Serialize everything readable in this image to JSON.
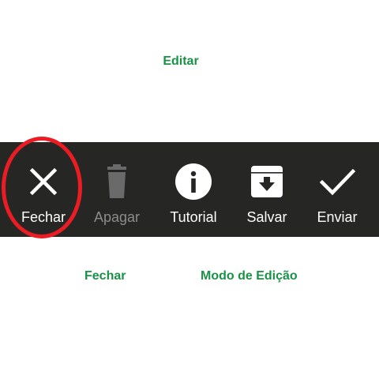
{
  "captions": {
    "top": "Editar",
    "bottom_left": "Fechar",
    "bottom_right": "Modo de Edição"
  },
  "toolbar": {
    "items": [
      {
        "label": "Fechar",
        "icon": "close-icon",
        "enabled": true
      },
      {
        "label": "Apagar",
        "icon": "trash-icon",
        "enabled": false
      },
      {
        "label": "Tutorial",
        "icon": "info-icon",
        "enabled": true
      },
      {
        "label": "Salvar",
        "icon": "archive-download-icon",
        "enabled": true
      },
      {
        "label": "Enviar",
        "icon": "checkmark-icon",
        "enabled": true
      }
    ]
  },
  "colors": {
    "caption": "#1a9147",
    "toolbar_bg": "#262624",
    "highlight": "#ea1c24",
    "disabled": "#6a6a6a"
  }
}
